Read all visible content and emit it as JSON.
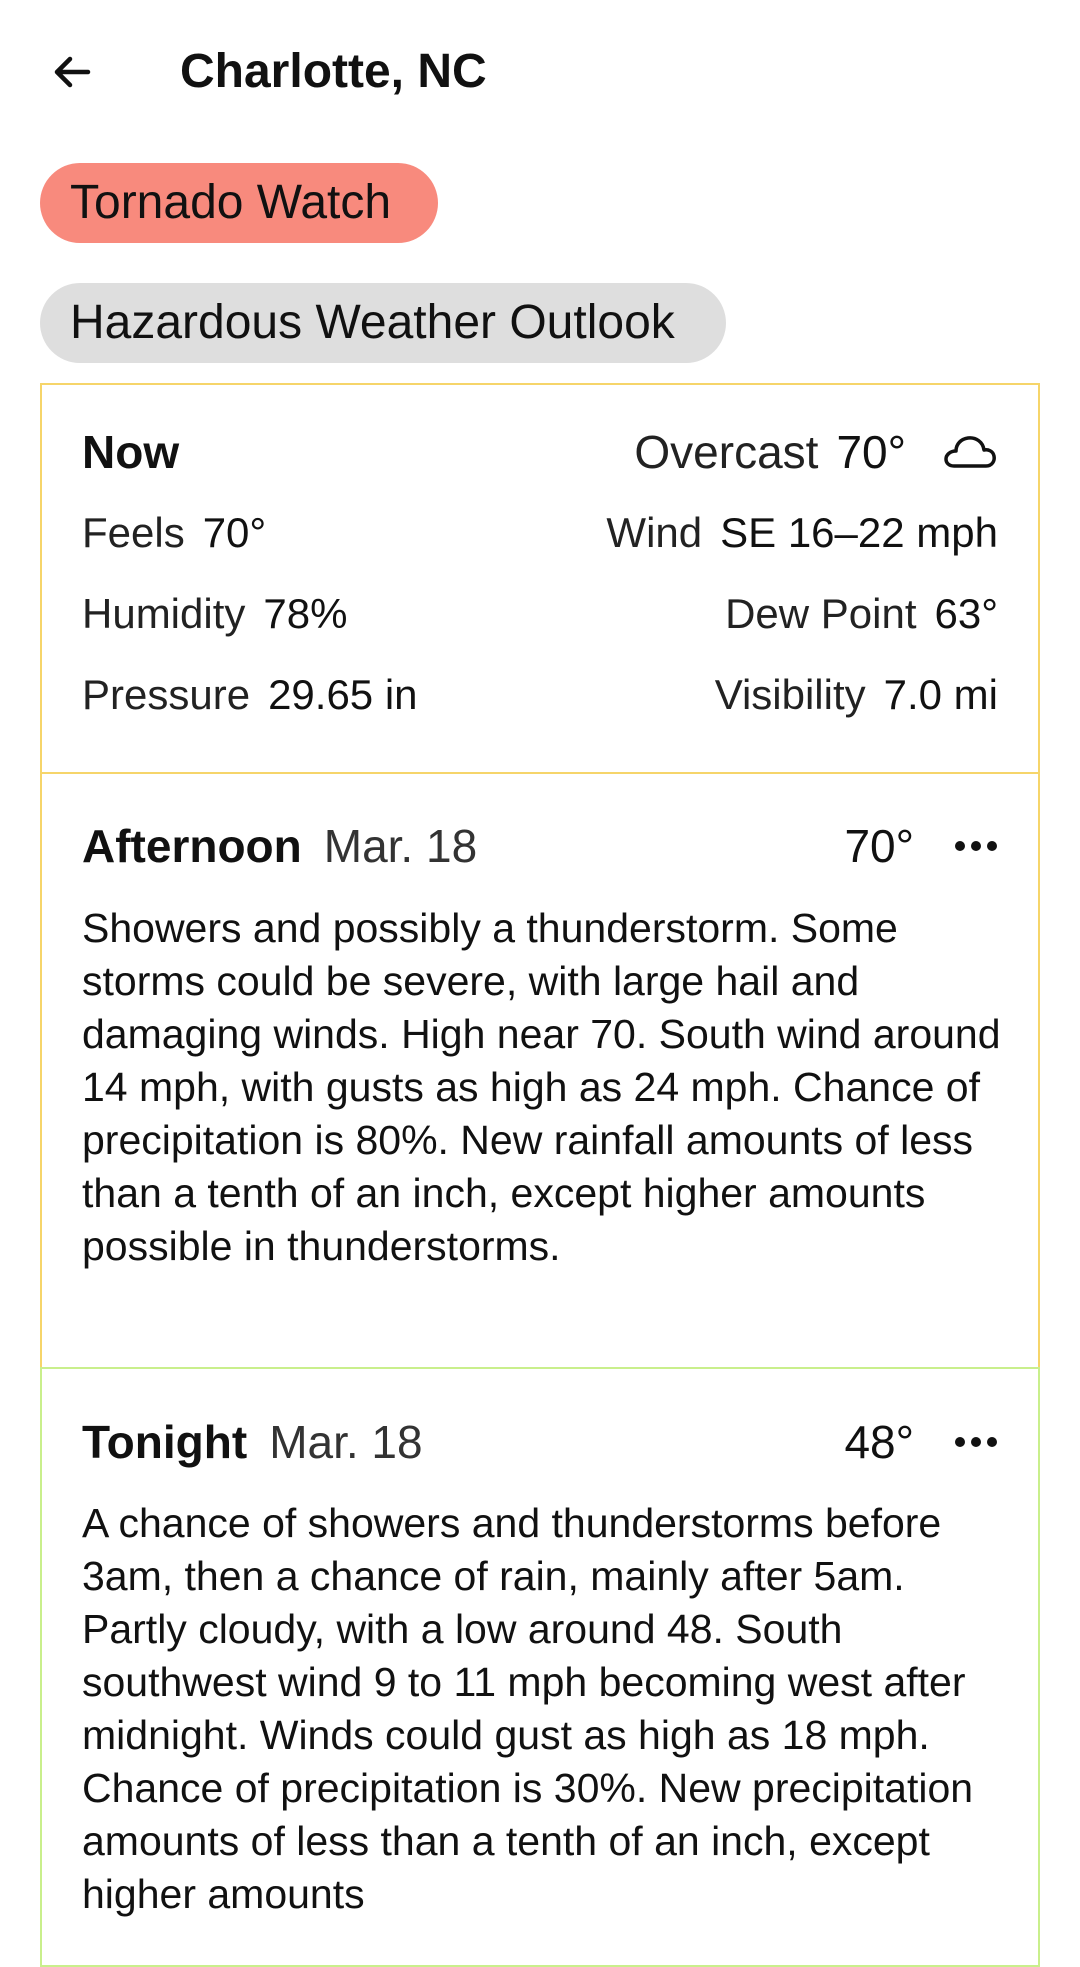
{
  "header": {
    "title": "Charlotte, NC"
  },
  "alerts": [
    {
      "label": "Tornado Watch",
      "color": "#f88a7d"
    },
    {
      "label": "Hazardous Weather Outlook",
      "color": "#dedede"
    }
  ],
  "now": {
    "heading": "Now",
    "condition": "Overcast",
    "temp": "70°",
    "icon": "cloud-icon",
    "feels_label": "Feels",
    "feels_value": "70°",
    "wind_label": "Wind",
    "wind_value": "SE 16–22 mph",
    "humidity_label": "Humidity",
    "humidity_value": "78%",
    "dew_label": "Dew Point",
    "dew_value": "63°",
    "pressure_label": "Pressure",
    "pressure_value": "29.65 in",
    "visibility_label": "Visibility",
    "visibility_value": "7.0 mi",
    "border_color": "#f6d56a"
  },
  "periods": [
    {
      "name": "Afternoon",
      "date": "Mar. 18",
      "temp": "70°",
      "description": "Showers and possibly a thunderstorm. Some storms could be severe, with large hail and damaging winds. High near 70. South wind around 14 mph, with gusts as high as 24 mph. Chance of precipitation is 80%. New rainfall amounts of less than a tenth of an inch, except higher amounts possible in thunderstorms.",
      "border_color": "#f6d56a"
    },
    {
      "name": "Tonight",
      "date": "Mar. 18",
      "temp": "48°",
      "description": "A chance of showers and thunderstorms before 3am, then a chance of rain, mainly after 5am. Partly cloudy, with a low around 48. South southwest wind 9 to 11 mph becoming west after midnight. Winds could gust as high as 18 mph. Chance of precipitation is 30%. New precipitation amounts of less than a tenth of an inch, except higher amounts",
      "border_color": "#c9ef8c"
    }
  ]
}
